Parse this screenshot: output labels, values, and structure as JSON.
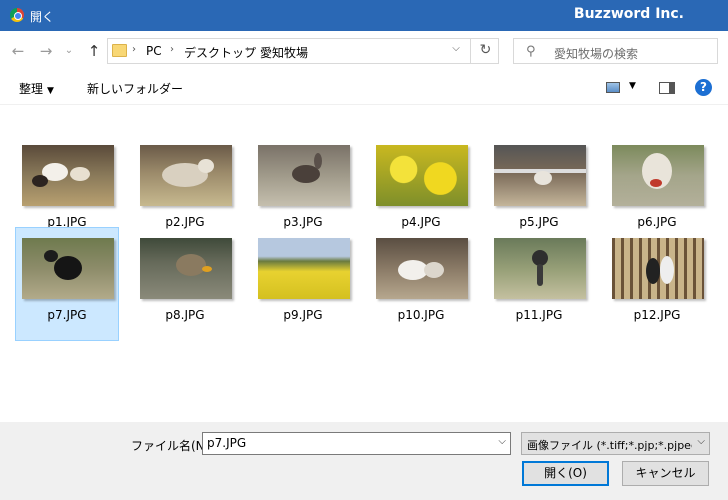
{
  "window": {
    "title": "開く",
    "brand": "Buzzword Inc."
  },
  "nav": {
    "back_icon": "←",
    "forward_icon": "→",
    "recent_icon": "⌄",
    "up_icon": "↑",
    "breadcrumb": [
      "PC",
      "デスクトップ",
      "愛知牧場"
    ],
    "separator": "›",
    "refresh_icon": "↻"
  },
  "search": {
    "placeholder": "愛知牧場の検索",
    "icon": "⚲"
  },
  "toolbar": {
    "organize_label": "整理",
    "dropdown_icon": "▼",
    "new_folder_label": "新しいフォルダー",
    "help_label": "?"
  },
  "files": [
    {
      "name": "p1.JPG",
      "selected": false
    },
    {
      "name": "p2.JPG",
      "selected": false
    },
    {
      "name": "p3.JPG",
      "selected": false
    },
    {
      "name": "p4.JPG",
      "selected": false
    },
    {
      "name": "p5.JPG",
      "selected": false
    },
    {
      "name": "p6.JPG",
      "selected": false
    },
    {
      "name": "p7.JPG",
      "selected": true
    },
    {
      "name": "p8.JPG",
      "selected": false
    },
    {
      "name": "p9.JPG",
      "selected": false
    },
    {
      "name": "p10.JPG",
      "selected": false
    },
    {
      "name": "p11.JPG",
      "selected": false
    },
    {
      "name": "p12.JPG",
      "selected": false
    }
  ],
  "bottom": {
    "filename_label": "ファイル名(N):",
    "filename_value": "p7.JPG",
    "filetype_value": "画像ファイル (*.tiff;*.pjp;*.pjpeg;*",
    "open_label": "開く(O)",
    "cancel_label": "キャンセル",
    "dd_icon": "⌵"
  }
}
